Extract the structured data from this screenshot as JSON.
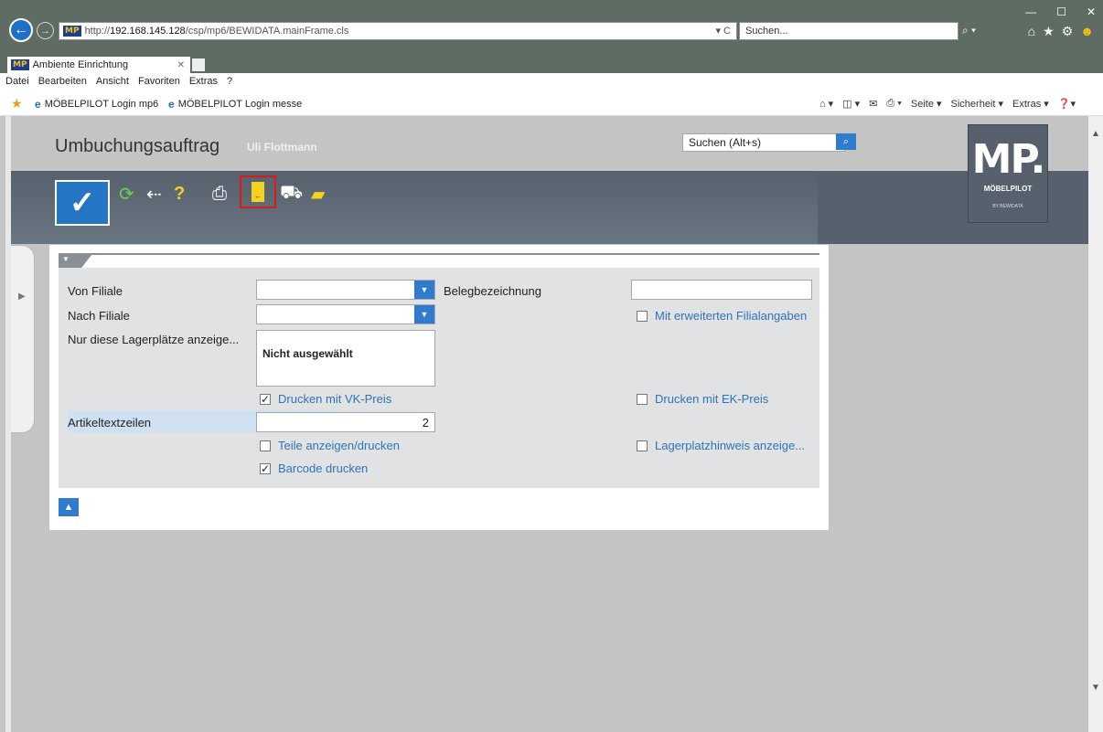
{
  "browser": {
    "url_prefix": "http://",
    "url_host": "192.168.145.128",
    "url_path": "/csp/mp6/BEWIDATA.mainFrame.cls",
    "url_controls": "▾ C",
    "search_placeholder": "Suchen...",
    "tab_title": "Ambiente Einrichtung",
    "menu": [
      "Datei",
      "Bearbeiten",
      "Ansicht",
      "Favoriten",
      "Extras",
      "?"
    ],
    "favorites": [
      "MÖBELPILOT Login mp6",
      "MÖBELPILOT Login messe"
    ],
    "commands": [
      "Seite ▾",
      "Sicherheit ▾",
      "Extras ▾"
    ]
  },
  "app": {
    "title": "Umbuchungsauftrag",
    "user": "Uli Flottmann",
    "search_value": "Suchen (Alt+s)",
    "brand_big": "MP.",
    "brand_sub": "MÖBELPILOT",
    "brand_tiny": "BY BEWIDATA"
  },
  "form": {
    "von_filiale_label": "Von Filiale",
    "nach_filiale_label": "Nach Filiale",
    "lagerplaetze_label": "Nur diese Lagerplätze anzeige...",
    "lagerplaetze_value": "Nicht ausgewählt",
    "belegbezeichnung_label": "Belegbezeichnung",
    "belegbezeichnung_value": "",
    "mit_erweiterten_label": "Mit erweiterten Filialangaben",
    "drucken_vk_label": "Drucken mit VK-Preis",
    "drucken_ek_label": "Drucken mit EK-Preis",
    "artikeltextzeilen_label": "Artikeltextzeilen",
    "artikeltextzeilen_value": "2",
    "teile_label": "Teile anzeigen/drucken",
    "lagerplatzhinweis_label": "Lagerplatzhinweis anzeige...",
    "barcode_label": "Barcode drucken",
    "checks": {
      "mit_erweiterten": false,
      "drucken_vk": true,
      "drucken_ek": false,
      "teile": false,
      "lagerplatzhinweis": false,
      "barcode": true
    }
  },
  "colors": {
    "accent": "#2f7ccf",
    "toolbar": "#56616d",
    "highlight": "#d81c1c"
  }
}
